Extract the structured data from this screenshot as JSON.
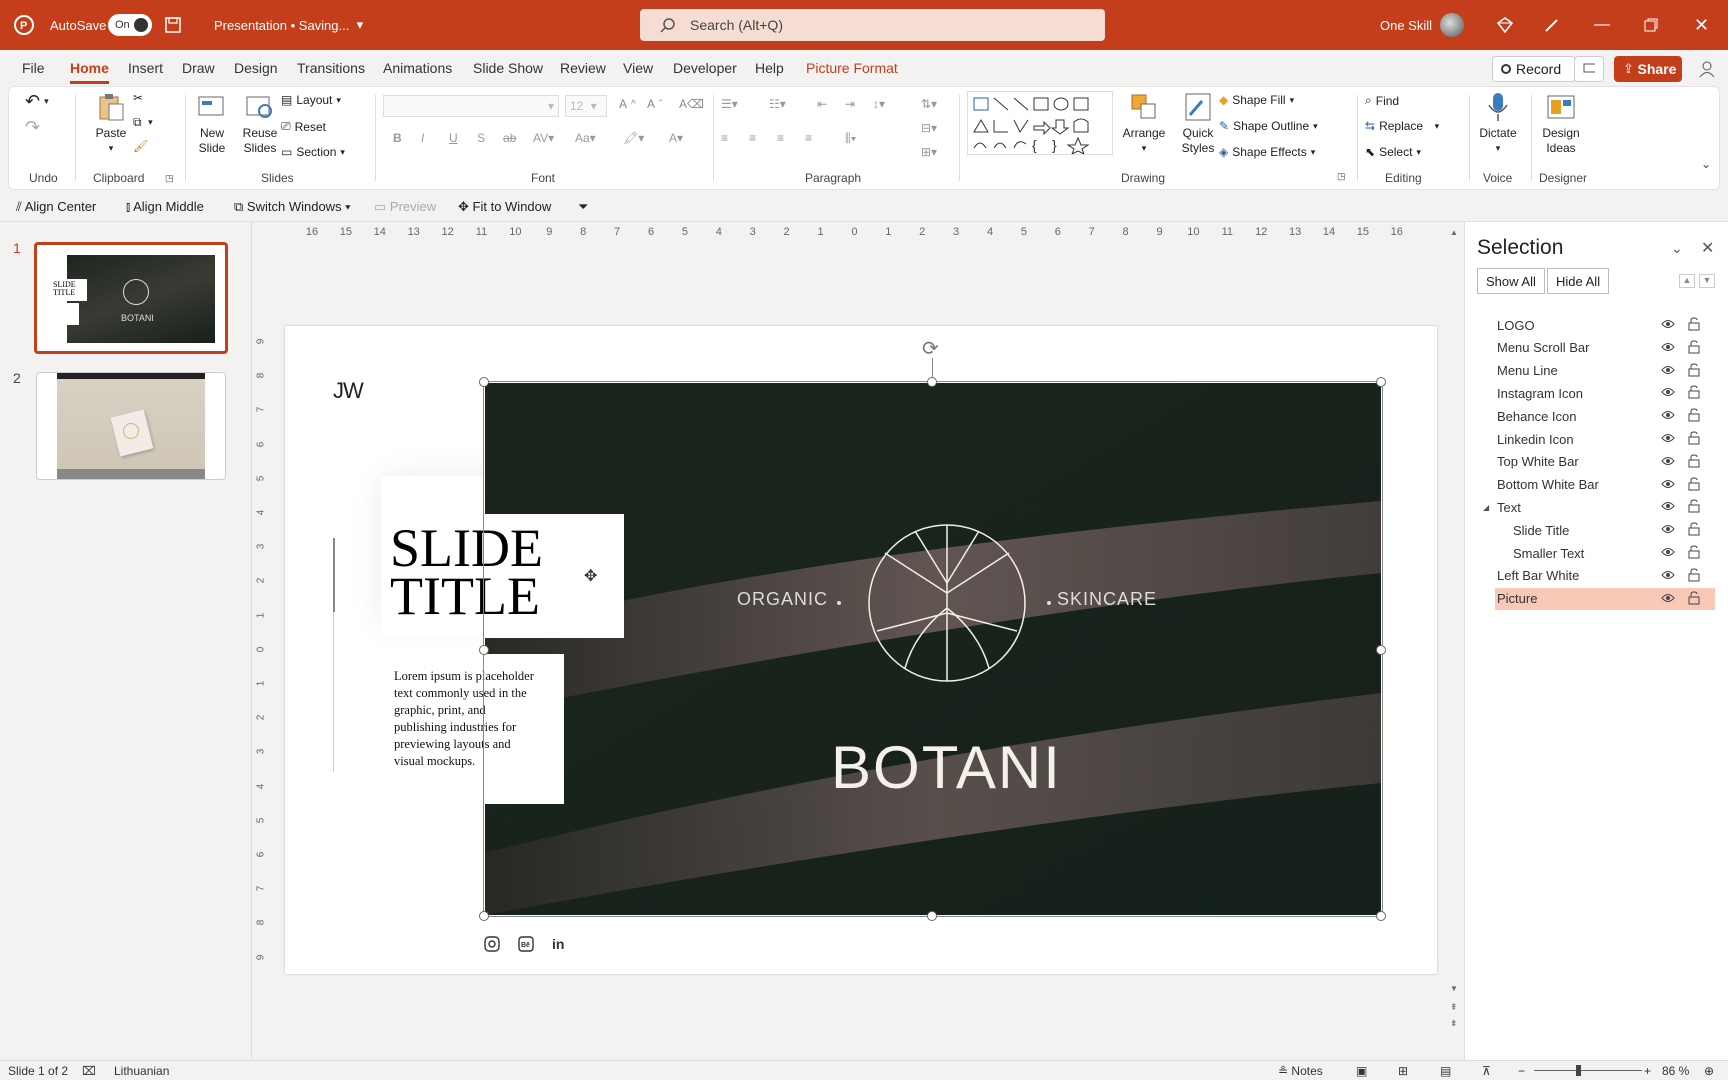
{
  "titlebar": {
    "autosave_label": "AutoSave",
    "autosave_state": "On",
    "doc_title": "Presentation • Saving...",
    "search_placeholder": "Search (Alt+Q)",
    "user_name": "One Skill"
  },
  "menu": {
    "tabs": [
      "File",
      "Home",
      "Insert",
      "Draw",
      "Design",
      "Transitions",
      "Animations",
      "Slide Show",
      "Review",
      "View",
      "Developer",
      "Help",
      "Picture Format"
    ],
    "active": "Home",
    "record_label": "Record",
    "share_label": "Share"
  },
  "ribbon": {
    "undo_group": "Undo",
    "clipboard_group": "Clipboard",
    "paste_label": "Paste",
    "slides_group": "Slides",
    "new_slide_label": "New Slide",
    "reuse_slides_label": "Reuse Slides",
    "layout_label": "Layout",
    "reset_label": "Reset",
    "section_label": "Section",
    "font_group": "Font",
    "font_size": "12",
    "paragraph_group": "Paragraph",
    "drawing_group": "Drawing",
    "arrange_label": "Arrange",
    "quick_styles_label": "Quick Styles",
    "shape_fill_label": "Shape Fill",
    "shape_outline_label": "Shape Outline",
    "shape_effects_label": "Shape Effects",
    "editing_group": "Editing",
    "find_label": "Find",
    "replace_label": "Replace",
    "select_label": "Select",
    "voice_group": "Voice",
    "dictate_label": "Dictate",
    "designer_group": "Designer",
    "design_ideas_label": "Design Ideas"
  },
  "qat": {
    "align_center": "Align Center",
    "align_middle": "Align Middle",
    "switch_windows": "Switch Windows",
    "preview": "Preview",
    "fit_to_window": "Fit to Window"
  },
  "thumbnails": {
    "slide1_num": "1",
    "slide2_num": "2",
    "slide1_title": "SLIDE TITLE",
    "slide1_brand": "BOTANI"
  },
  "ruler": {
    "h_ticks": [
      "16",
      "15",
      "14",
      "13",
      "12",
      "11",
      "10",
      "9",
      "8",
      "7",
      "6",
      "5",
      "4",
      "3",
      "2",
      "1",
      "0",
      "1",
      "2",
      "3",
      "4",
      "5",
      "6",
      "7",
      "8",
      "9",
      "10",
      "11",
      "12",
      "13",
      "14",
      "15",
      "16"
    ],
    "v_ticks": [
      "9",
      "8",
      "7",
      "6",
      "5",
      "4",
      "3",
      "2",
      "1",
      "0",
      "1",
      "2",
      "3",
      "4",
      "5",
      "6",
      "7",
      "8",
      "9"
    ]
  },
  "slide": {
    "logo": "JW",
    "title_line1": "SLIDE",
    "title_line2": "TITLE",
    "body": "Lorem ipsum is placeholder text commonly used in the graphic, print, and publishing industries for previewing layouts and visual mockups.",
    "organic": "ORGANIC",
    "skincare": "SKINCARE",
    "brand": "BOTANI"
  },
  "selection_pane": {
    "title": "Selection",
    "show_all": "Show All",
    "hide_all": "Hide All",
    "items": [
      "LOGO",
      "Menu Scroll Bar",
      "Menu Line",
      "Instagram Icon",
      "Behance Icon",
      "Linkedin Icon",
      "Top White Bar",
      "Bottom White Bar",
      "Text",
      "Slide Title",
      "Smaller Text",
      "Left Bar White",
      "Picture"
    ],
    "selected": "Picture"
  },
  "status": {
    "slide_info": "Slide 1 of 2",
    "language": "Lithuanian",
    "notes_label": "Notes",
    "zoom": "86 %"
  },
  "colors": {
    "accent": "#c43e1c",
    "selected_row": "#f8c9b6"
  }
}
